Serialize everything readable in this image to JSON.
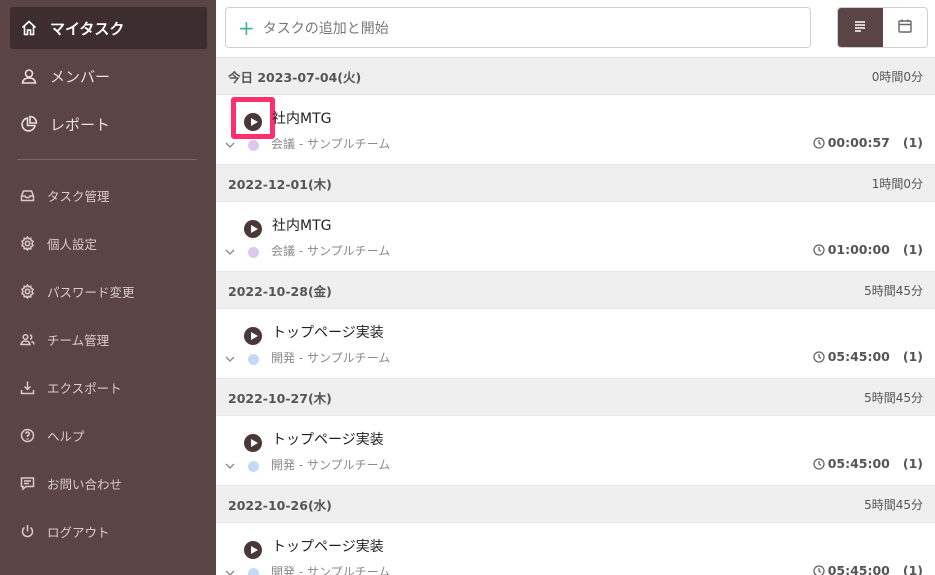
{
  "sidebar": {
    "main_items": [
      {
        "label": "マイタスク",
        "icon": "home-icon",
        "active": true
      },
      {
        "label": "メンバー",
        "icon": "user-icon",
        "active": false
      },
      {
        "label": "レポート",
        "icon": "pie-chart-icon",
        "active": false
      }
    ],
    "sub_items": [
      {
        "label": "タスク管理",
        "icon": "inbox-icon"
      },
      {
        "label": "個人設定",
        "icon": "gear-icon"
      },
      {
        "label": "パスワード変更",
        "icon": "gear-icon"
      },
      {
        "label": "チーム管理",
        "icon": "team-icon"
      },
      {
        "label": "エクスポート",
        "icon": "download-icon"
      },
      {
        "label": "ヘルプ",
        "icon": "help-icon"
      },
      {
        "label": "お問い合わせ",
        "icon": "message-icon"
      },
      {
        "label": "ログアウト",
        "icon": "power-icon"
      }
    ]
  },
  "topbar": {
    "add_task_label": "タスクの追加と開始",
    "view_modes": [
      "list",
      "calendar"
    ],
    "active_view": "list"
  },
  "colors": {
    "sidebar_bg": "#5a4445",
    "active_nav_bg": "#3d2d2e",
    "accent_plus": "#3db89a",
    "highlight": "#ff2e6c",
    "meeting_dot": "#dcc8ec",
    "dev_dot": "#c3d9f5"
  },
  "days": [
    {
      "date": "今日 2023-07-04(火)",
      "total": "0時間0分",
      "tasks": [
        {
          "name": "社内MTG",
          "category": "会議 - サンプルチーム",
          "dot": "#dcc8ec",
          "time": "00:00:57",
          "count": "(1)",
          "highlighted": true
        }
      ]
    },
    {
      "date": "2022-12-01(木)",
      "total": "1時間0分",
      "tasks": [
        {
          "name": "社内MTG",
          "category": "会議 - サンプルチーム",
          "dot": "#dcc8ec",
          "time": "01:00:00",
          "count": "(1)",
          "highlighted": false
        }
      ]
    },
    {
      "date": "2022-10-28(金)",
      "total": "5時間45分",
      "tasks": [
        {
          "name": "トップページ実装",
          "category": "開発 - サンプルチーム",
          "dot": "#c3d9f5",
          "time": "05:45:00",
          "count": "(1)",
          "highlighted": false
        }
      ]
    },
    {
      "date": "2022-10-27(木)",
      "total": "5時間45分",
      "tasks": [
        {
          "name": "トップページ実装",
          "category": "開発 - サンプルチーム",
          "dot": "#c3d9f5",
          "time": "05:45:00",
          "count": "(1)",
          "highlighted": false
        }
      ]
    },
    {
      "date": "2022-10-26(水)",
      "total": "5時間45分",
      "tasks": [
        {
          "name": "トップページ実装",
          "category": "開発 - サンプルチーム",
          "dot": "#c3d9f5",
          "time": "05:45:00",
          "count": "(1)",
          "highlighted": false
        }
      ]
    }
  ]
}
